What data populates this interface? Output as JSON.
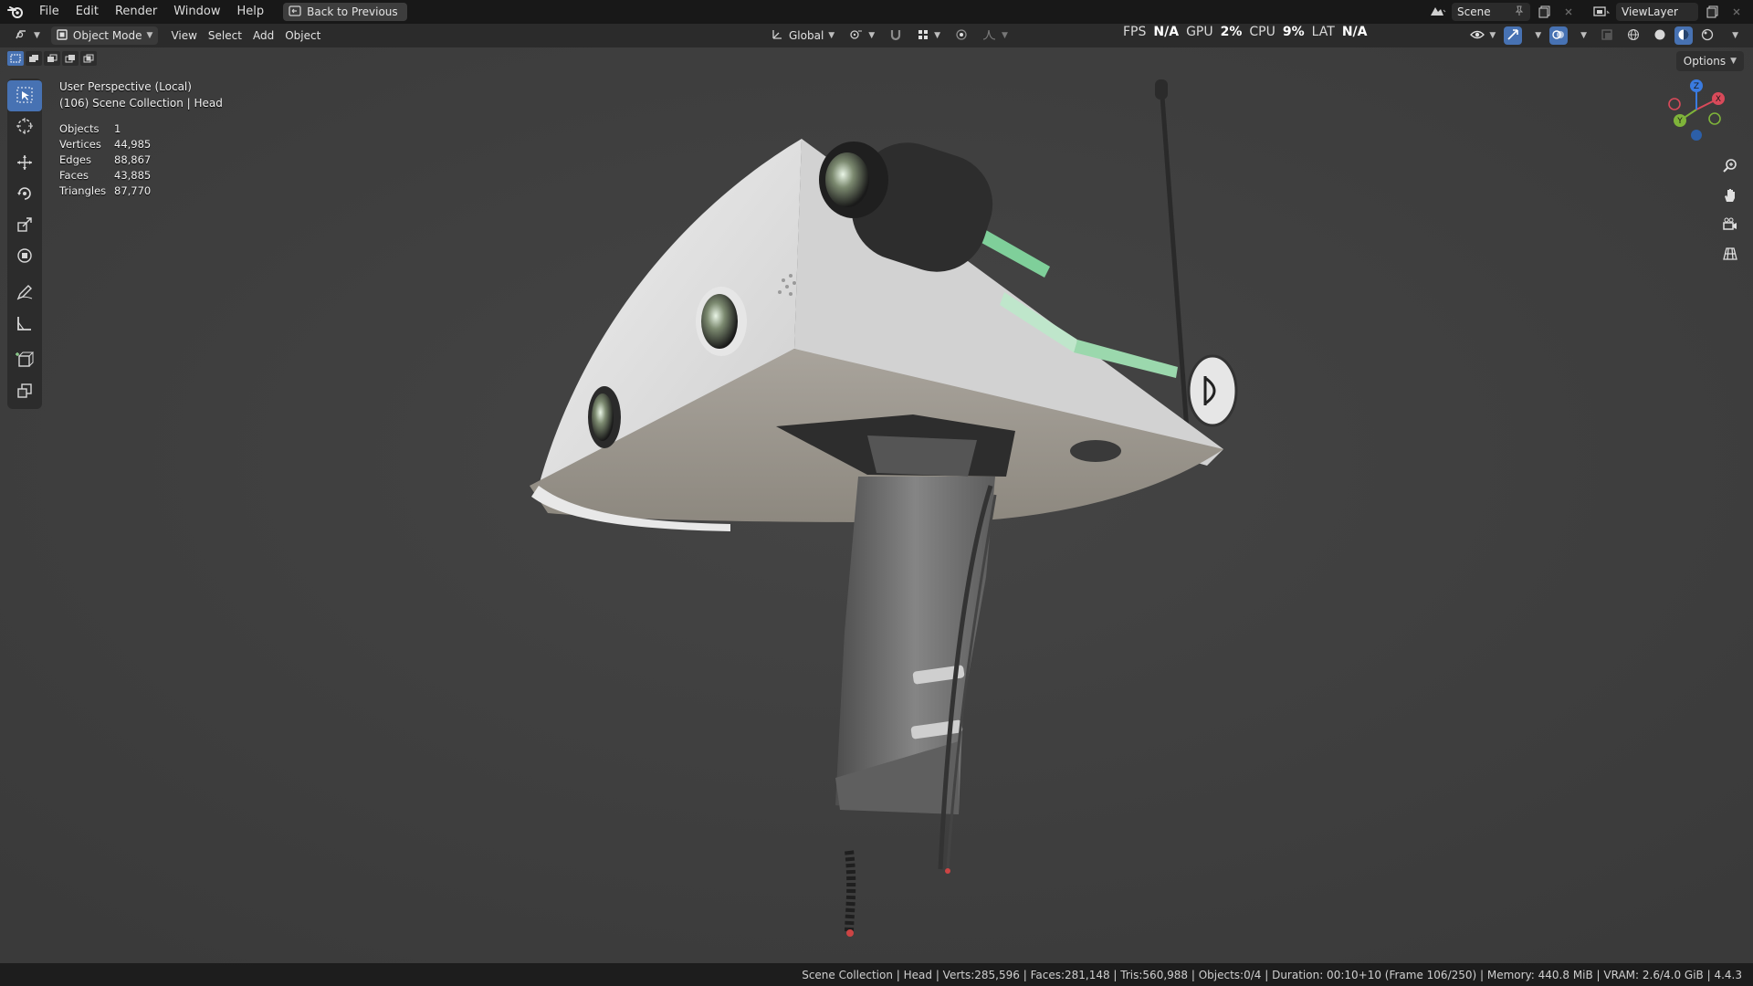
{
  "menu": {
    "items": [
      "File",
      "Edit",
      "Render",
      "Window",
      "Help"
    ],
    "back_label": "Back to Previous"
  },
  "top_right": {
    "scene": "Scene",
    "view_layer": "ViewLayer"
  },
  "header": {
    "mode": "Object Mode",
    "menus": [
      "View",
      "Select",
      "Add",
      "Object"
    ],
    "transform_orientation": "Global"
  },
  "perf": {
    "fps_label": "FPS",
    "fps_value": "N/A",
    "gpu_label": "GPU",
    "gpu_value": "2%",
    "cpu_label": "CPU",
    "cpu_value": "9%",
    "lat_label": "LAT",
    "lat_value": "N/A"
  },
  "viewport": {
    "perspective": "User Perspective (Local)",
    "collection": "(106) Scene Collection | Head",
    "options_label": "Options",
    "stats": [
      {
        "key": "Objects",
        "value": "1"
      },
      {
        "key": "Vertices",
        "value": "44,985"
      },
      {
        "key": "Edges",
        "value": "88,867"
      },
      {
        "key": "Faces",
        "value": "43,885"
      },
      {
        "key": "Triangles",
        "value": "87,770"
      }
    ],
    "gizmo": {
      "x": "X",
      "y": "Y",
      "z": "Z"
    }
  },
  "statusbar": {
    "text": "Scene Collection | Head | Verts:285,596 | Faces:281,148 | Tris:560,988 | Objects:0/4 | Duration: 00:10+10 (Frame 106/250) | Memory: 440.8 MiB | VRAM: 2.6/4.0 GiB | 4.4.3"
  },
  "colors": {
    "accent": "#4772b3",
    "viewport_bg": "#3f3f3f",
    "header_bg": "#2b2b2b",
    "model_white": "#dcdcdc",
    "model_stripe": "#7fcf9a",
    "model_dark": "#5a5a5a"
  }
}
